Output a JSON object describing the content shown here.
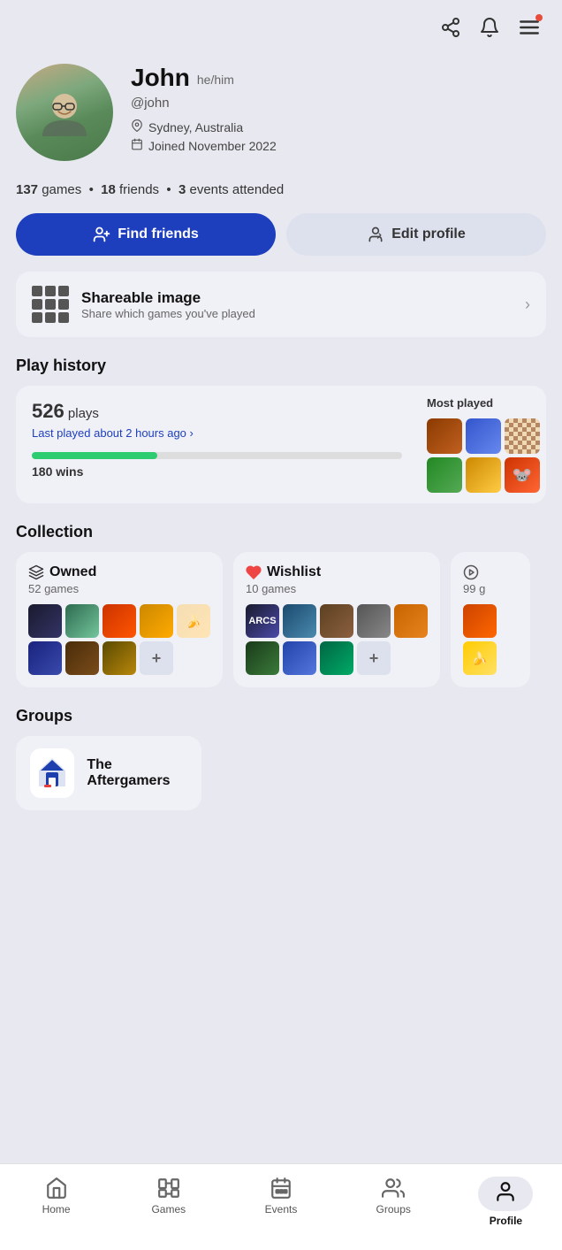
{
  "header": {
    "share_icon": "⇧",
    "bell_icon": "🔔",
    "menu_icon": "☰"
  },
  "profile": {
    "name": "John",
    "pronouns": "he/him",
    "handle": "@john",
    "location": "Sydney, Australia",
    "joined": "Joined November 2022",
    "avatar_emoji": "😊"
  },
  "stats": {
    "games": "137",
    "games_label": "games",
    "friends": "18",
    "friends_label": "friends",
    "events": "3",
    "events_label": "events attended"
  },
  "buttons": {
    "find_friends": "Find friends",
    "edit_profile": "Edit profile"
  },
  "shareable": {
    "title": "Shareable image",
    "subtitle": "Share which games you've played"
  },
  "play_history": {
    "section_title": "Play history",
    "plays_count": "526",
    "plays_label": "plays",
    "last_played": "Last played about 2 hours ago",
    "wins": "180",
    "wins_label": "wins",
    "progress_pct": 34,
    "most_played_label": "Most played",
    "games": [
      {
        "color": "rust"
      },
      {
        "color": "blue"
      },
      {
        "color": "chess"
      },
      {
        "color": "green"
      },
      {
        "color": "purple"
      },
      {
        "color": "yellow"
      }
    ]
  },
  "collection": {
    "section_title": "Collection",
    "owned": {
      "label": "Owned",
      "count": "52 games",
      "games": [
        {
          "color": "dark"
        },
        {
          "color": "teal"
        },
        {
          "color": "red"
        },
        {
          "color": "brown"
        },
        {
          "color": "tan"
        },
        {
          "color": "navy"
        },
        {
          "color": "lime"
        },
        {
          "color": "yellow"
        },
        {
          "color": "plus"
        }
      ]
    },
    "wishlist": {
      "label": "Wishlist",
      "count": "10 games",
      "games": [
        {
          "color": "dark"
        },
        {
          "color": "teal"
        },
        {
          "color": "orange"
        },
        {
          "color": "gray"
        },
        {
          "color": "rust"
        },
        {
          "color": "brown"
        },
        {
          "color": "green"
        },
        {
          "color": "blue"
        },
        {
          "color": "plus"
        }
      ]
    },
    "third": {
      "count": "99 g"
    }
  },
  "groups": {
    "section_title": "Groups",
    "items": [
      {
        "name": "The Aftergamers",
        "icon": "🏠"
      }
    ]
  },
  "bottom_nav": {
    "items": [
      {
        "label": "Home",
        "icon": "home"
      },
      {
        "label": "Games",
        "icon": "games"
      },
      {
        "label": "Events",
        "icon": "events"
      },
      {
        "label": "Groups",
        "icon": "groups"
      },
      {
        "label": "Profile",
        "icon": "profile",
        "active": true
      }
    ]
  }
}
